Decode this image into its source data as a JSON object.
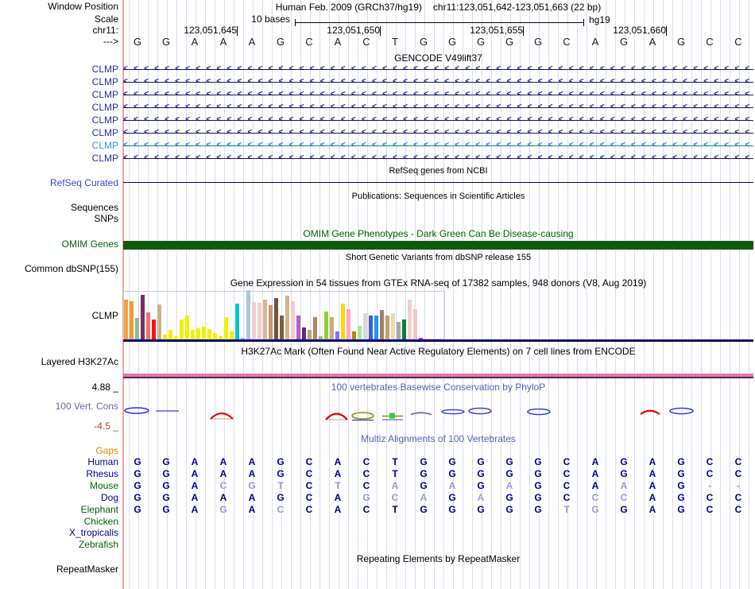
{
  "header": {
    "window_position_label": "Window Position",
    "assembly": "Human Feb. 2009 (GRCh37/hg19)",
    "position": "chr11:123,051,642-123,051,663 (22 bp)",
    "scale_label": "Scale",
    "scale_value": "10 bases",
    "assembly_short": "hg19",
    "chrom_label": "chr11:",
    "strand_arrow": "--->"
  },
  "ruler": {
    "tick_labels": [
      "123,051,645",
      "123,051,650",
      "123,051,655",
      "123,051,660"
    ],
    "bases": "GGAAAGCACTGGGGGCAGAGCC"
  },
  "gencode": {
    "title": "GENCODE V49lift37",
    "gene_rows": [
      {
        "label": "CLMP",
        "variant": "normal"
      },
      {
        "label": "CLMP",
        "variant": "normal"
      },
      {
        "label": "CLMP",
        "variant": "normal"
      },
      {
        "label": "CLMP",
        "variant": "normal"
      },
      {
        "label": "CLMP",
        "variant": "normal"
      },
      {
        "label": "CLMP",
        "variant": "normal"
      },
      {
        "label": "CLMP",
        "variant": "alt"
      },
      {
        "label": "CLMP",
        "variant": "normal"
      }
    ]
  },
  "refseq": {
    "title": "RefSeq genes from NCBI",
    "label": "RefSeq Curated"
  },
  "publications": {
    "title": "Publications: Sequences in Scientific Articles",
    "sequences_label": "Sequences",
    "snps_label": "SNPs"
  },
  "omim": {
    "title": "OMIM Gene Phenotypes - Dark Green Can Be Disease-causing",
    "label": "OMIM Genes"
  },
  "dbsnp": {
    "title": "Short Genetic Variants from dbSNP release 155",
    "label": "Common dbSNP(155)"
  },
  "gtex": {
    "title": "Gene Expression in 54 tissues from GTEx RNA-seq of 17382 samples, 948 donors (V8, Aug 2019)",
    "label": "CLMP"
  },
  "chart_data": {
    "type": "bar",
    "title": "Gene Expression in 54 tissues from GTEx RNA-seq of 17382 samples, 948 donors (V8, Aug 2019)",
    "note": "54 GTEx tissue expression bars for CLMP; heights read in pixels from baseline (max 62)",
    "ylim": [
      0,
      62
    ],
    "values": [
      50,
      48,
      27,
      56,
      34,
      25,
      44,
      6,
      12,
      4,
      25,
      30,
      12,
      14,
      16,
      13,
      8,
      4,
      28,
      10,
      45,
      2,
      62,
      47,
      46,
      50,
      43,
      52,
      30,
      55,
      48,
      30,
      15,
      12,
      28,
      4,
      35,
      28,
      10,
      45,
      38,
      10,
      17,
      33,
      30,
      30,
      37,
      30,
      33,
      22,
      25,
      50,
      38,
      2
    ],
    "colors": [
      "#f5a23c",
      "#ef9b39",
      "#8fbc8f",
      "#7b2d68",
      "#e8756a",
      "#ff1111",
      "#cbb190",
      "#f0f000",
      "#f0f000",
      "#f0f000",
      "#f0f000",
      "#f0f000",
      "#f0f000",
      "#f0f000",
      "#f0f000",
      "#f0f000",
      "#f0f000",
      "#f0f000",
      "#f0f000",
      "#f0f000",
      "#00c5cd",
      "#ee82ee",
      "#a8c7e0",
      "#f2cfcf",
      "#f2cfcf",
      "#d3b793",
      "#c49a6c",
      "#6b5644",
      "#7d5f3f",
      "#d2b48c",
      "#f0cccc",
      "#b65fc9",
      "#5e2b7e",
      "#c9a06a",
      "#b5845a",
      "#b0a79b",
      "#8fcd32",
      "#cdaa7d",
      "#8470ff",
      "#ffd700",
      "#ffa6c9",
      "#b8860b",
      "#a0e8a0",
      "#d9d9d9",
      "#3a5fcd",
      "#1e90ff",
      "#9c8265",
      "#c69c6d",
      "#ecd9b0",
      "#a9a9a9",
      "#0a7d45",
      "#f2cfcf",
      "#edc8c8",
      "#ff00ff"
    ]
  },
  "h3k27ac": {
    "title": "H3K27Ac Mark (Often Found Near Active Regulatory Elements) on 7 cell lines from ENCODE",
    "label": "Layered H3K27Ac"
  },
  "phylop": {
    "title": "100 vertebrates Basewise Conservation by PhyloP",
    "label": "100 Vert. Cons",
    "max_value": "4.88 _",
    "min_value": "-4.5 _"
  },
  "multiz": {
    "title": "Multiz Alignments of 100 Vertebrates",
    "gaps_label": "Gaps",
    "species": [
      {
        "name": "Human",
        "color": "navy",
        "seq": "GGAAAGCACTGGGGGCAGAGCC"
      },
      {
        "name": "Rhesus",
        "color": "navy",
        "seq": "GGAAAGCACTGGGGGCAGAGCC"
      },
      {
        "name": "Mouse",
        "color": "green",
        "seq": "GGAcgtCtCaGaGaGCAaAG--"
      },
      {
        "name": "Dog",
        "color": "navy",
        "seq": "GGAAAGCAgcaGaGGCccAGCC"
      },
      {
        "name": "Elephant",
        "color": "green",
        "seq": "GGAgAcCACTGGGGGtgGAGCC"
      },
      {
        "name": "Chicken",
        "color": "green",
        "seq": ""
      },
      {
        "name": "X_tropicalis",
        "color": "navy",
        "seq": ""
      },
      {
        "name": "Zebrafish",
        "color": "green",
        "seq": ""
      }
    ]
  },
  "repeatmasker": {
    "title": "Repeating Elements by RepeatMasker",
    "label": "RepeatMasker"
  },
  "colors": {
    "omim_green": "#0c5c0c",
    "refseq_line_navy": "#000080",
    "gtex_baseline_navy": "#0b0b6b",
    "h3k27ac_pink": "#f46eb0",
    "grid_lavender": "#dcdcee",
    "window_edge_salmon": "#f0a3a3"
  }
}
